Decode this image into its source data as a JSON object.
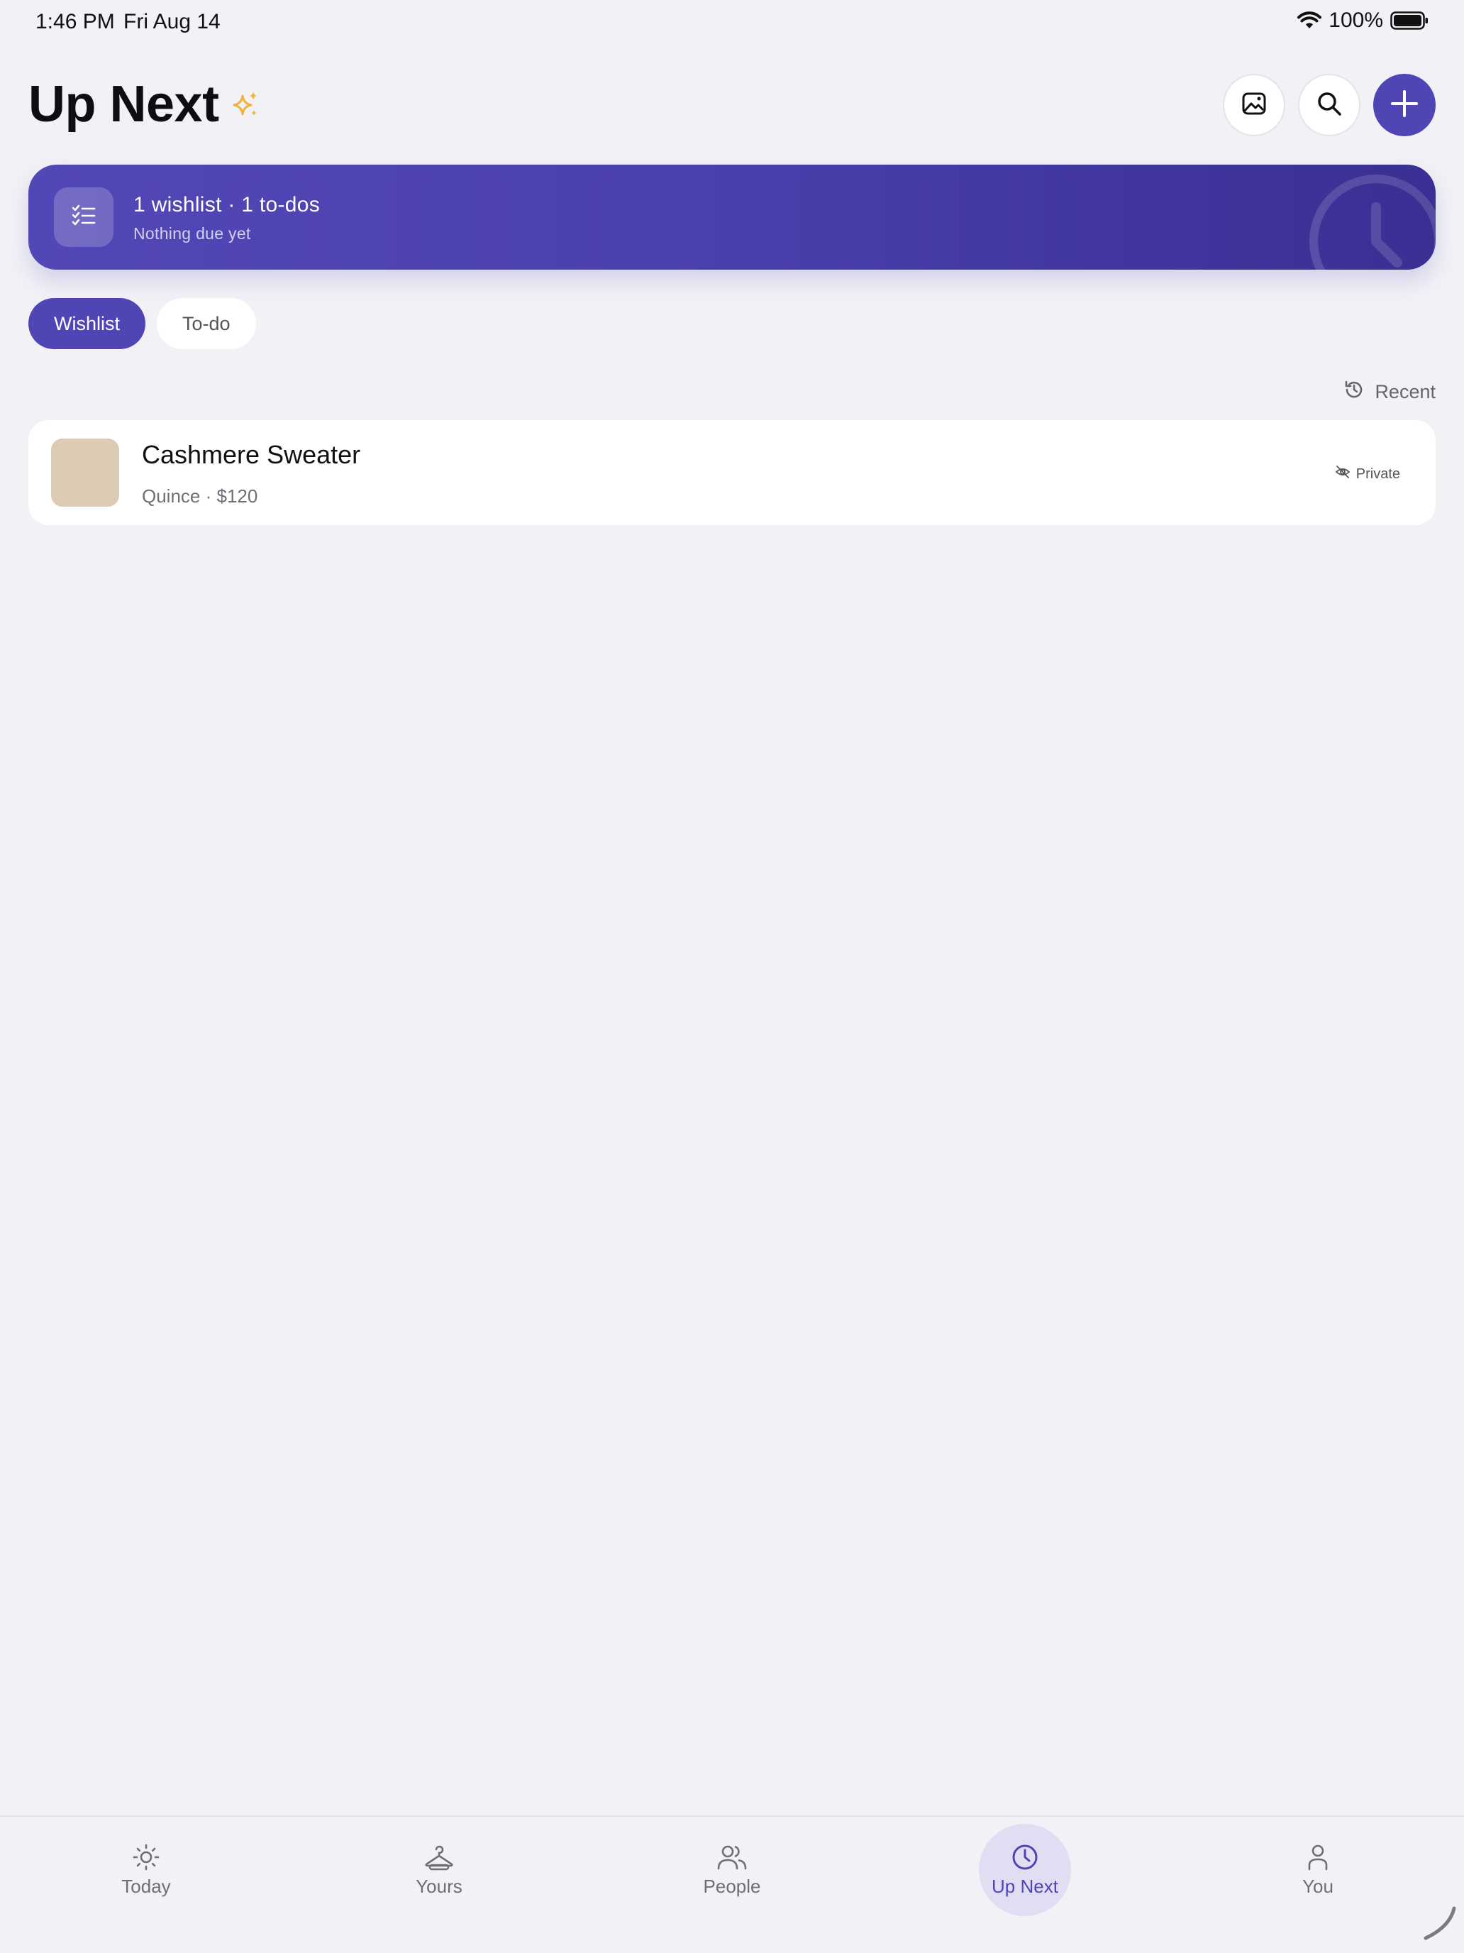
{
  "status_bar": {
    "time": "1:46 PM",
    "date": "Fri Aug 14",
    "battery": "100%"
  },
  "header": {
    "title": "Up Next",
    "icons": [
      "sparkle-icon",
      "image-icon",
      "search-icon",
      "plus-icon"
    ]
  },
  "summary": {
    "title": "1 wishlist · 1 to-dos",
    "subtitle": "Nothing due yet"
  },
  "tabs": [
    {
      "label": "Wishlist",
      "active": true
    },
    {
      "label": "To-do",
      "active": false
    }
  ],
  "sort": {
    "label": "Recent"
  },
  "items": [
    {
      "name": "Cashmere Sweater",
      "meta": "Quince · $120",
      "privacy": "Private"
    }
  ],
  "bottom_nav": [
    {
      "label": "Today",
      "icon": "sun-icon"
    },
    {
      "label": "Yours",
      "icon": "hanger-icon"
    },
    {
      "label": "People",
      "icon": "people-icon"
    },
    {
      "label": "Up Next",
      "icon": "clock-icon",
      "active": true
    },
    {
      "label": "You",
      "icon": "person-icon"
    }
  ],
  "colors": {
    "accent": "#4f45b5",
    "background": "#f1f1f6",
    "sparkle": "#f0b43c"
  }
}
